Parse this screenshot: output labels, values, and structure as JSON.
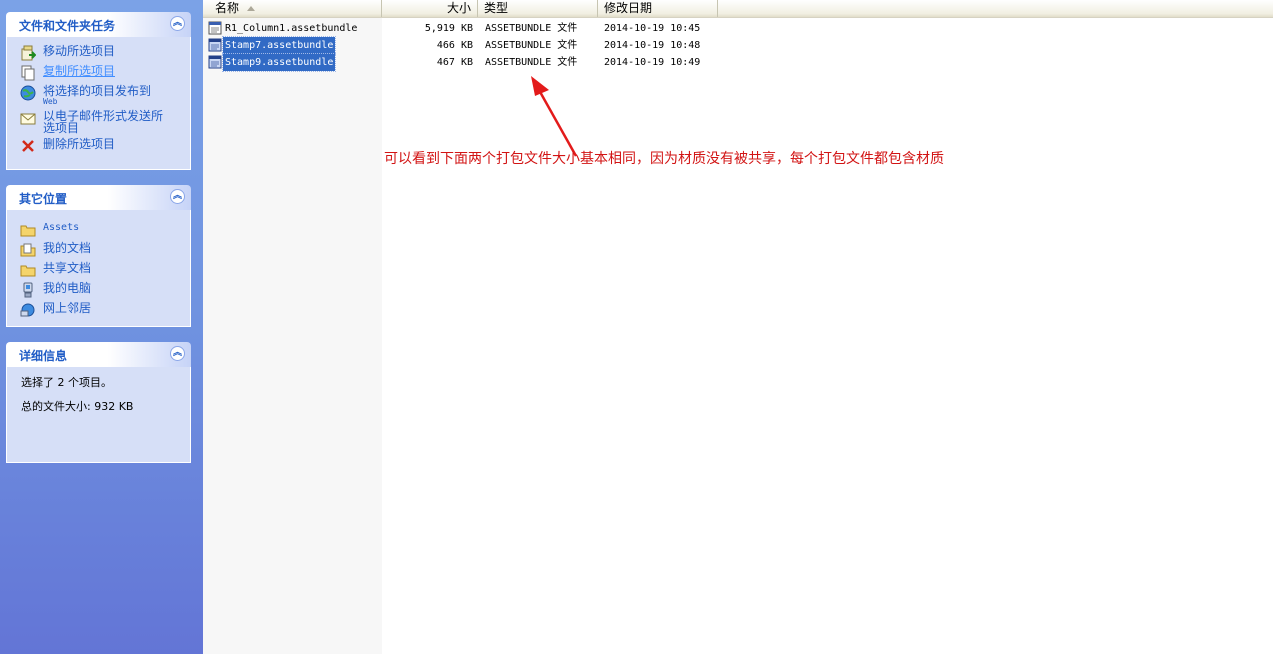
{
  "task_pane": {
    "file_tasks": {
      "title": "文件和文件夹任务",
      "items": [
        {
          "label": "移动所选项目",
          "icon": "move-icon"
        },
        {
          "label": "复制所选项目",
          "icon": "copy-icon"
        },
        {
          "label": "将选择的项目发布到",
          "sub": "Web",
          "icon": "publish-web-icon"
        },
        {
          "label": "以电子邮件形式发送所",
          "sub2": "选项目",
          "icon": "email-icon"
        },
        {
          "label": "删除所选项目",
          "icon": "delete-icon"
        }
      ]
    },
    "other_places": {
      "title": "其它位置",
      "items": [
        {
          "label": "Assets",
          "icon": "folder-icon"
        },
        {
          "label": "我的文档",
          "icon": "my-documents-icon"
        },
        {
          "label": "共享文档",
          "icon": "shared-folder-icon"
        },
        {
          "label": "我的电脑",
          "icon": "my-computer-icon"
        },
        {
          "label": "网上邻居",
          "icon": "network-icon"
        }
      ]
    },
    "details": {
      "title": "详细信息",
      "selected_text": "选择了 2 个项目。",
      "total_size_text": "总的文件大小: 932 KB"
    },
    "collapse_glyph": "︽"
  },
  "list": {
    "columns": {
      "name": "名称",
      "size": "大小",
      "type": "类型",
      "modified": "修改日期"
    },
    "rows": [
      {
        "name": "R1_Column1.assetbundle",
        "size": "5,919 KB",
        "type": "ASSETBUNDLE 文件",
        "modified": "2014-10-19 10:45",
        "selected": false
      },
      {
        "name": "Stamp7.assetbundle",
        "size": "466 KB",
        "type": "ASSETBUNDLE 文件",
        "modified": "2014-10-19 10:48",
        "selected": true
      },
      {
        "name": "Stamp9.assetbundle",
        "size": "467 KB",
        "type": "ASSETBUNDLE 文件",
        "modified": "2014-10-19 10:49",
        "selected": true
      }
    ]
  },
  "annotation": {
    "text": "可以看到下面两个打包文件大小基本相同，因为材质没有被共享，每个打包文件都包含材质",
    "color": "#d21414"
  },
  "colors": {
    "task_link": "#215dc6",
    "selection": "#316ac5",
    "pane_top": "#7ba2e7",
    "pane_bottom": "#6375d6"
  }
}
